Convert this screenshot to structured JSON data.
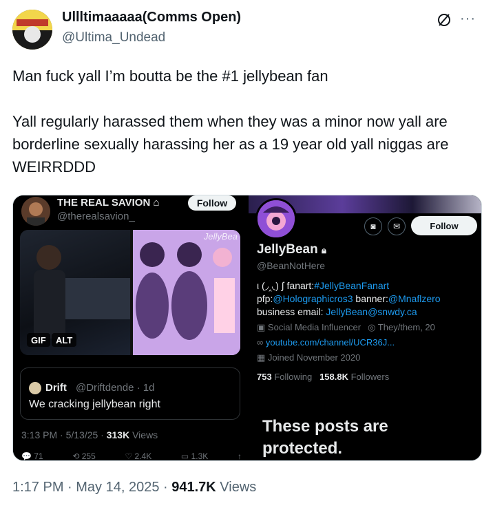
{
  "author": {
    "name": "Ullltimaaaaa(Comms Open)",
    "handle": "@Ultima_Undead"
  },
  "header_icons": {
    "no_edit": "slashed-circle-icon",
    "more": "···"
  },
  "tweet": {
    "line1": "Man fuck yall I’m boutta be the #1 jellybean fan",
    "line2": "Yall regularly harassed them when they was a minor now yall are borderline sexually harassing her as a 19 year old yall niggas are WEIRRDDD"
  },
  "left_screenshot": {
    "name": "THE REAL SAVION",
    "handle": "@therealsavion_",
    "follow_label": "Follow",
    "art_watermark": "JellyBea",
    "badge_gif": "GIF",
    "badge_alt": "ALT",
    "reply": {
      "name": "Drift",
      "handle": "@Driftdende · 1d",
      "text": "We cracking jellybean right"
    },
    "meta_time": "3:13 PM · 5/13/25 · ",
    "meta_views_count": "313K",
    "meta_views_label": " Views",
    "actions": [
      "71",
      "255",
      "2.4K",
      "1.3K"
    ]
  },
  "right_screenshot": {
    "follow_label": "Follow",
    "name": "JellyBean",
    "handle": "@BeanNotHere",
    "bio_line1_text": "ι (◞‸◟) ∫ fanart:",
    "bio_line1_link": "#JellyBeanFanart",
    "bio_line2_pfp": "pfp:",
    "bio_line2_pfp_link": "@Holographicros3",
    "bio_line2_banner": " banner:",
    "bio_line2_banner_link": "@Mnaflzero",
    "bio_line3_text": "business email: ",
    "bio_line3_link": "JellyBean@snwdy.ca",
    "category": "Social Media Influencer",
    "pronouns": "They/them, 20",
    "website": "youtube.com/channel/UCR36J...",
    "joined": "Joined November 2020",
    "following_count": "753",
    "following_label": " Following",
    "followers_count": "158.8K",
    "followers_label": " Followers",
    "protected_text": "These posts are protected."
  },
  "footer": {
    "time": "1:17 PM · May 14, 2025 · ",
    "views_count": "941.7K",
    "views_label": " Views"
  },
  "colors": {
    "link": "#1d9bf0",
    "muted": "#536471",
    "dark_bg": "#000000"
  }
}
